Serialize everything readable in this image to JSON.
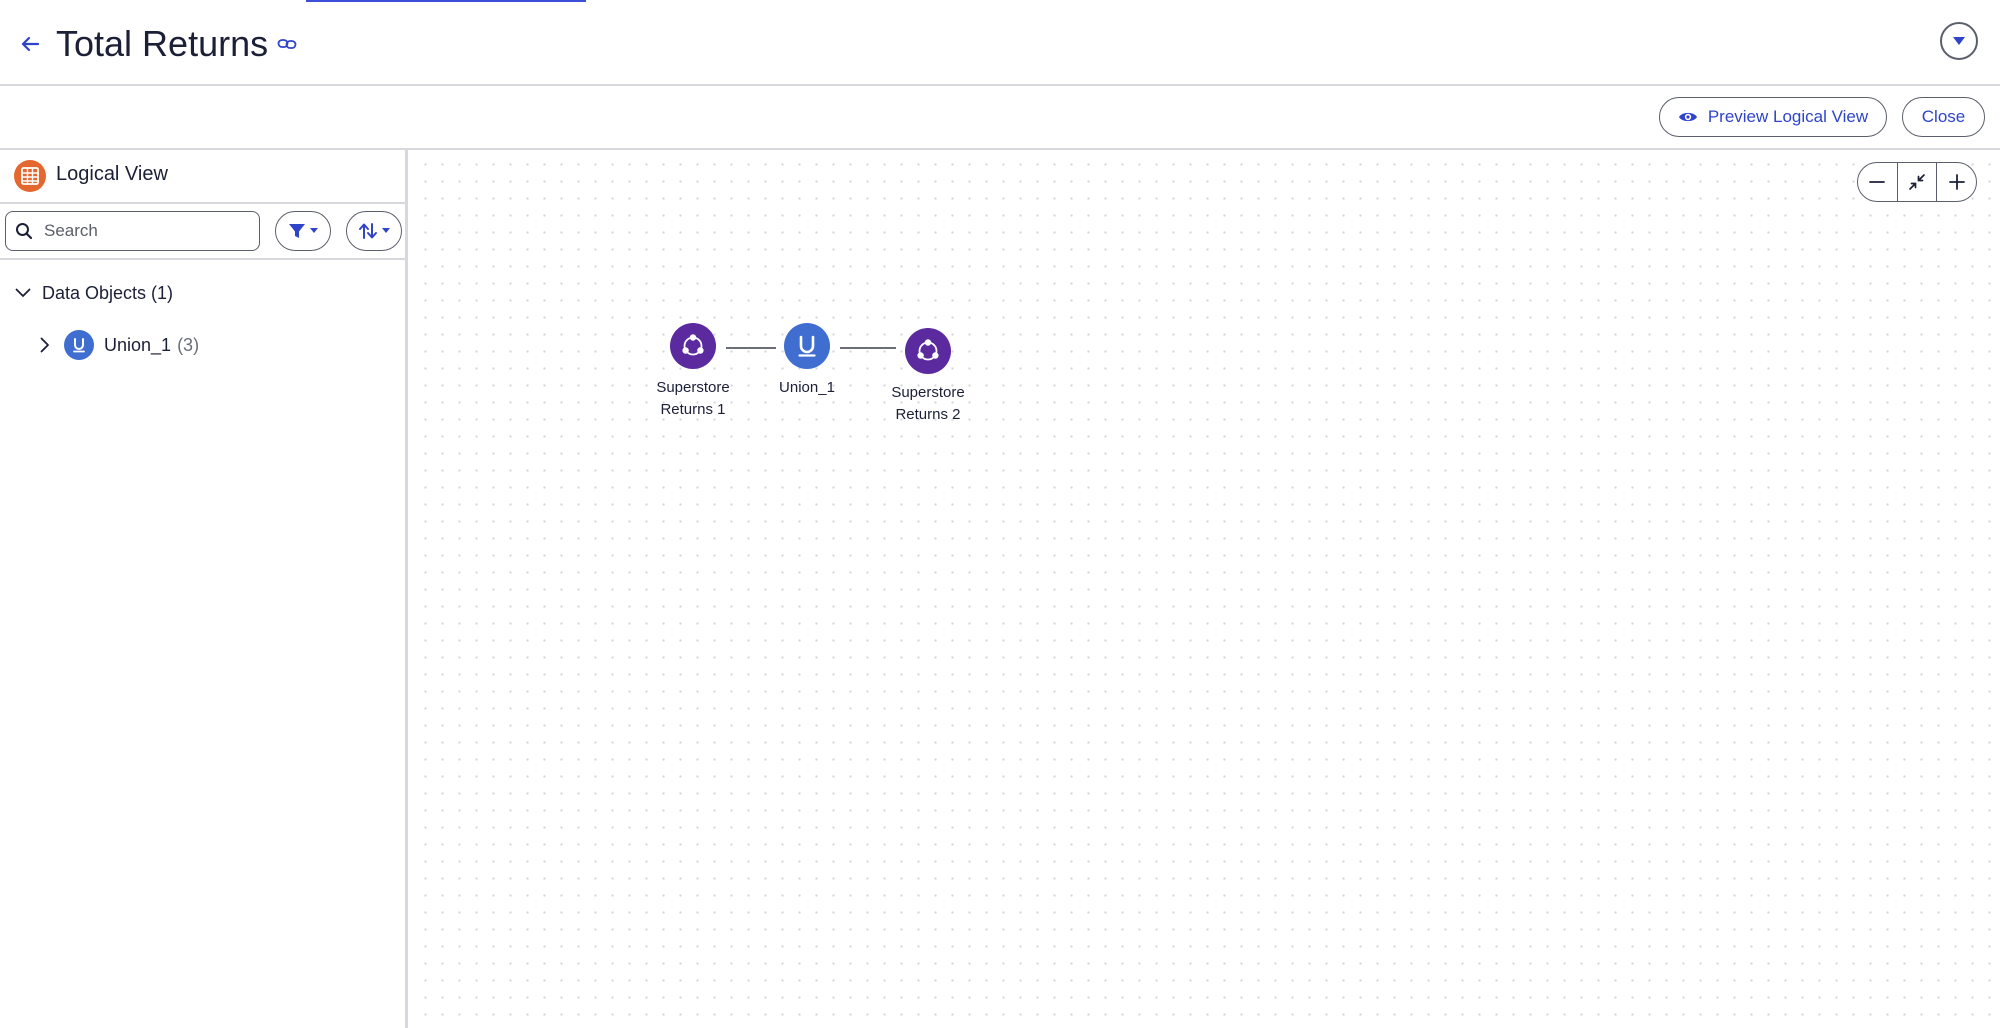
{
  "header": {
    "title": "Total Returns",
    "back_icon": "arrow-left-icon",
    "link_icon": "link-icon",
    "menu_icon": "caret-down-icon"
  },
  "toolbar": {
    "preview_label": "Preview Logical View",
    "close_label": "Close"
  },
  "left_panel": {
    "title": "Logical View",
    "title_icon": "table-icon",
    "search": {
      "placeholder": "Search",
      "value": ""
    },
    "filter_icon": "filter-icon",
    "sort_icon": "sort-icon",
    "tree": {
      "group_label": "Data Objects (1)",
      "items": [
        {
          "label": "Union_1",
          "count": "(3)",
          "icon": "union-icon"
        }
      ]
    }
  },
  "canvas": {
    "zoom_out_icon": "minus-icon",
    "fit_icon": "collapse-icon",
    "zoom_in_icon": "plus-icon",
    "nodes": [
      {
        "id": "n1",
        "label_line1": "Superstore",
        "label_line2": "Returns 1",
        "icon": "dataset-icon"
      },
      {
        "id": "n2",
        "label_line1": "Union_1",
        "label_line2": "",
        "icon": "union-icon"
      },
      {
        "id": "n3",
        "label_line1": "Superstore",
        "label_line2": "Returns 2",
        "icon": "dataset-icon"
      }
    ]
  },
  "colors": {
    "accent": "#2f44c8",
    "purple_node": "#5a2a9e",
    "blue_node": "#3f6ed0",
    "panel_icon": "#e4672f"
  }
}
